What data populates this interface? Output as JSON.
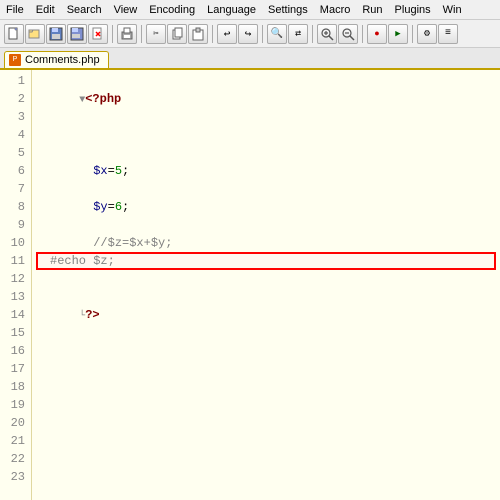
{
  "menubar": {
    "items": [
      "File",
      "Edit",
      "Search",
      "View",
      "Encoding",
      "Language",
      "Settings",
      "Macro",
      "Run",
      "Plugins",
      "Win"
    ]
  },
  "toolbar": {
    "buttons": [
      {
        "name": "new",
        "icon": "📄"
      },
      {
        "name": "open",
        "icon": "📂"
      },
      {
        "name": "save",
        "icon": "💾"
      },
      {
        "name": "save-all",
        "icon": "💾"
      },
      {
        "name": "close",
        "icon": "✕"
      },
      {
        "name": "print",
        "icon": "🖨"
      },
      {
        "name": "cut",
        "icon": "✂"
      },
      {
        "name": "copy",
        "icon": "📋"
      },
      {
        "name": "paste",
        "icon": "📌"
      },
      {
        "name": "undo",
        "icon": "↩"
      },
      {
        "name": "redo",
        "icon": "↪"
      },
      {
        "name": "find",
        "icon": "🔍"
      },
      {
        "name": "replace",
        "icon": "⇄"
      },
      {
        "name": "zoom-in",
        "icon": "+"
      },
      {
        "name": "zoom-out",
        "icon": "-"
      },
      {
        "name": "macro",
        "icon": "M"
      },
      {
        "name": "run",
        "icon": "▶"
      },
      {
        "name": "sync",
        "icon": "⚙"
      },
      {
        "name": "menu",
        "icon": "≡"
      }
    ]
  },
  "tab": {
    "label": "Comments.php",
    "icon": "P"
  },
  "lines": [
    {
      "num": 1,
      "content": "<?php",
      "type": "php-tag",
      "has-collapse": true
    },
    {
      "num": 2,
      "content": "",
      "type": "normal"
    },
    {
      "num": 3,
      "content": "",
      "type": "normal"
    },
    {
      "num": 4,
      "content": "",
      "type": "normal"
    },
    {
      "num": 5,
      "content": "$x=5;",
      "type": "code"
    },
    {
      "num": 6,
      "content": "",
      "type": "normal"
    },
    {
      "num": 7,
      "content": "$y=6;",
      "type": "code"
    },
    {
      "num": 8,
      "content": "",
      "type": "normal"
    },
    {
      "num": 9,
      "content": "//$z=$x+$y;",
      "type": "comment"
    },
    {
      "num": 10,
      "content": "",
      "type": "normal"
    },
    {
      "num": 11,
      "content": "#echo $z;",
      "type": "selected"
    },
    {
      "num": 12,
      "content": "",
      "type": "normal"
    },
    {
      "num": 13,
      "content": "?>",
      "type": "php-end"
    },
    {
      "num": 14,
      "content": "",
      "type": "normal"
    },
    {
      "num": 15,
      "content": "",
      "type": "normal"
    },
    {
      "num": 16,
      "content": "",
      "type": "normal"
    },
    {
      "num": 17,
      "content": "",
      "type": "normal"
    },
    {
      "num": 18,
      "content": "",
      "type": "normal"
    },
    {
      "num": 19,
      "content": "",
      "type": "normal"
    },
    {
      "num": 20,
      "content": "",
      "type": "normal"
    },
    {
      "num": 21,
      "content": "",
      "type": "normal"
    },
    {
      "num": 22,
      "content": "",
      "type": "normal"
    },
    {
      "num": 23,
      "content": "",
      "type": "normal"
    }
  ]
}
